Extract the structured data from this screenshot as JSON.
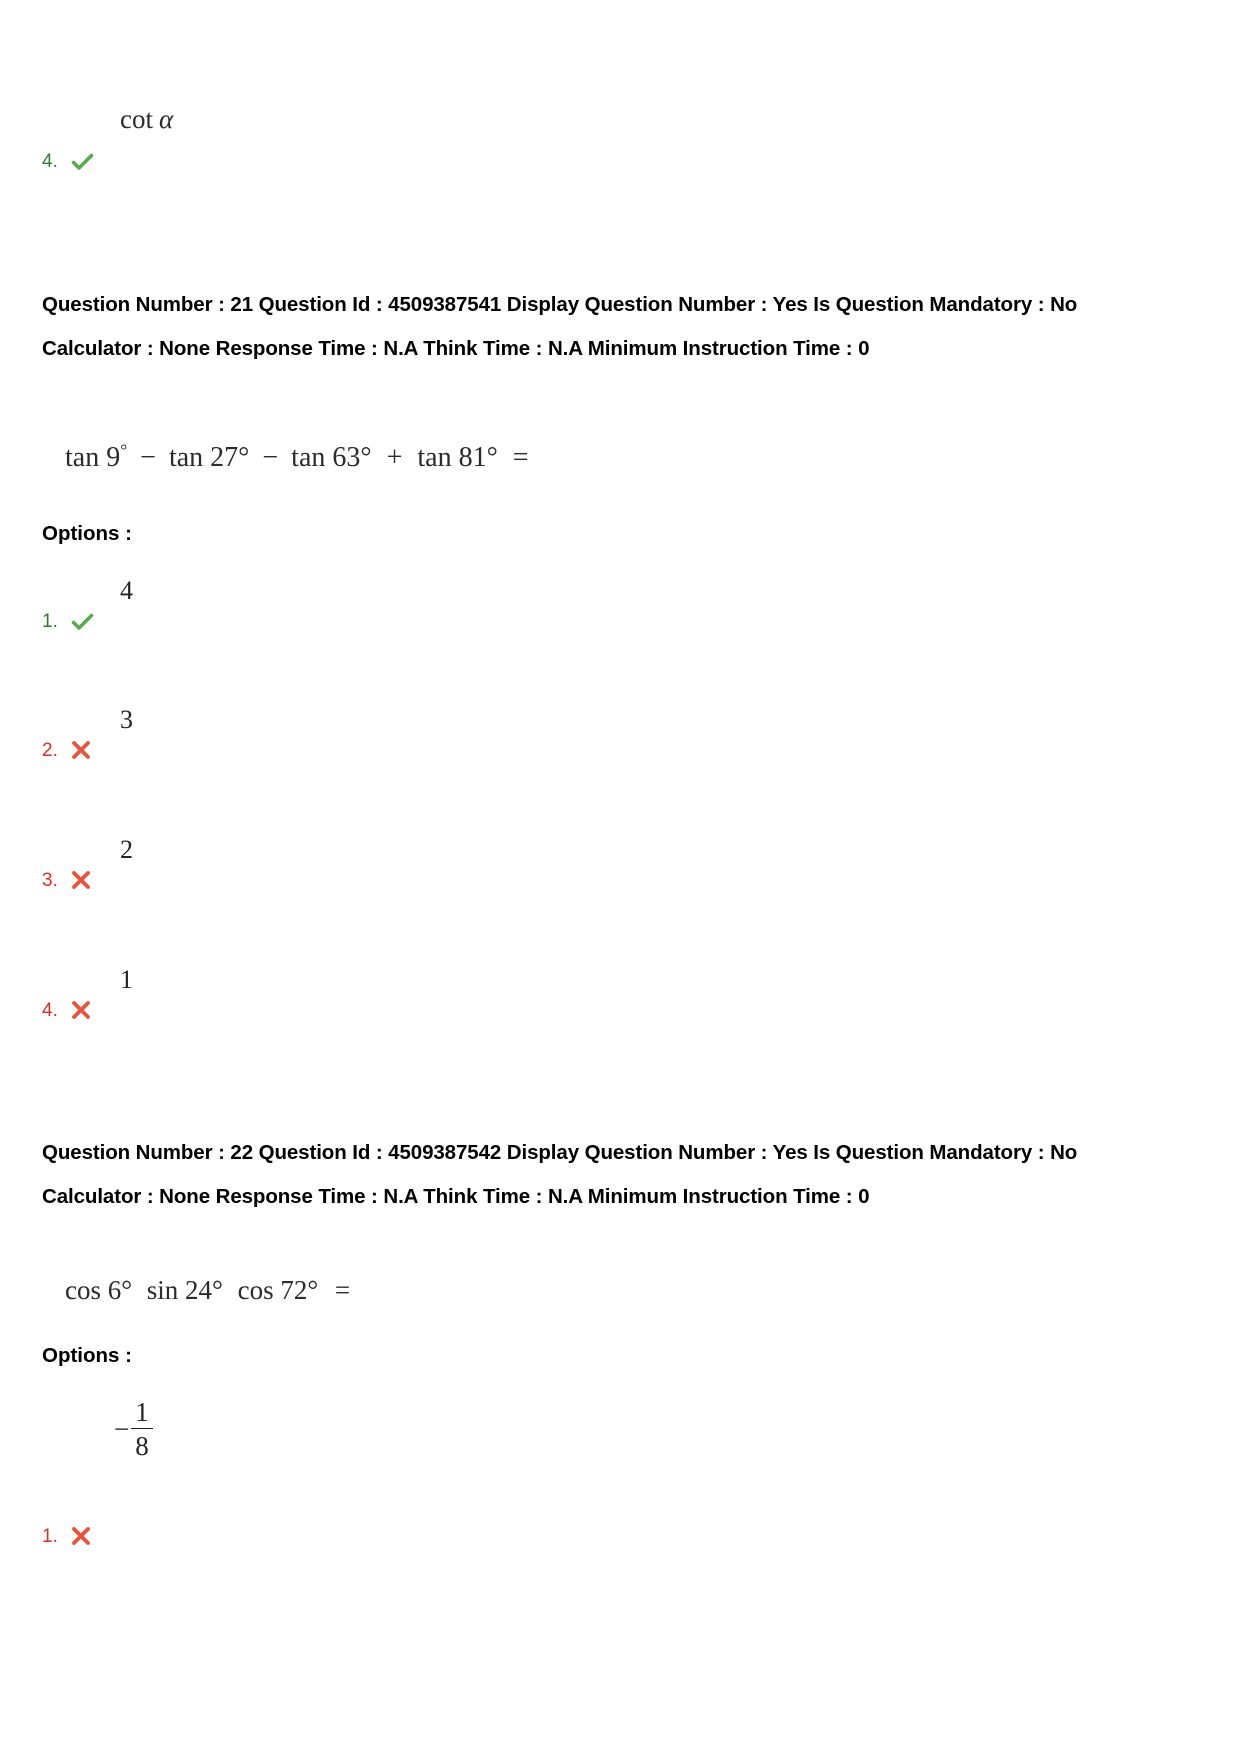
{
  "document": {
    "type": "exam-question-paper",
    "colors": {
      "correct": "#2e7d32",
      "wrong": "#d93025",
      "text": "#000000",
      "math": "#232323",
      "background": "#ffffff"
    }
  },
  "top_fragment": {
    "option_number": "4.",
    "marker": "check-icon",
    "status": "correct",
    "expression_prefix": "cot",
    "expression_symbol": "α"
  },
  "questions": [
    {
      "meta_line": "Question Number : 21 Question Id : 4509387541 Display Question Number : Yes Is Question Mandatory : No Calculator : None Response Time : N.A Think Time : N.A Minimum Instruction Time : 0",
      "question_number": "21",
      "question_id": "4509387541",
      "display_question_number": "Yes",
      "is_question_mandatory": "No",
      "calculator": "None",
      "response_time": "N.A",
      "think_time": "N.A",
      "minimum_instruction_time": "0",
      "stem_parts": {
        "t1": "tan 9",
        "d1": "°",
        "op1": "−",
        "t2": "tan 27°",
        "op2": "−",
        "t3": "tan 63°",
        "op3": "+",
        "t4": "tan 81°",
        "eq": "="
      },
      "options_label": "Options :",
      "options": [
        {
          "number": "1.",
          "marker": "check-icon",
          "status": "correct",
          "value": "4"
        },
        {
          "number": "2.",
          "marker": "cross-icon",
          "status": "wrong",
          "value": "3"
        },
        {
          "number": "3.",
          "marker": "cross-icon",
          "status": "wrong",
          "value": "2"
        },
        {
          "number": "4.",
          "marker": "cross-icon",
          "status": "wrong",
          "value": "1"
        }
      ]
    },
    {
      "meta_line": "Question Number : 22 Question Id : 4509387542 Display Question Number : Yes Is Question Mandatory : No Calculator : None Response Time : N.A Think Time : N.A Minimum Instruction Time : 0",
      "question_number": "22",
      "question_id": "4509387542",
      "display_question_number": "Yes",
      "is_question_mandatory": "No",
      "calculator": "None",
      "response_time": "N.A",
      "think_time": "N.A",
      "minimum_instruction_time": "0",
      "stem_parts": {
        "t1": "cos 6°",
        "t2": "sin 24°",
        "t3": "cos 72°",
        "eq": "="
      },
      "options_label": "Options :",
      "options": [
        {
          "number": "1.",
          "marker": "cross-icon",
          "status": "wrong",
          "sign": "−",
          "numerator": "1",
          "denominator": "8"
        }
      ]
    }
  ]
}
